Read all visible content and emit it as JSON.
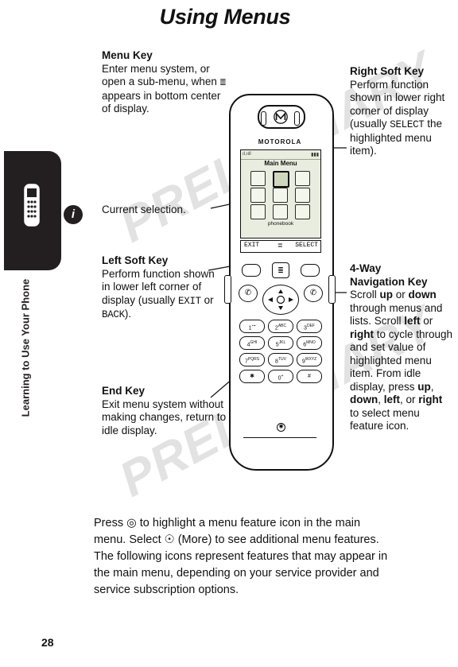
{
  "page": {
    "title": "Using Menus",
    "number": "28",
    "side_tab_label": "Learning to Use Your Phone",
    "watermark": "PRELIMINARY"
  },
  "callouts": {
    "menu_key": {
      "heading": "Menu Key",
      "body_1": "Enter menu system, or open a sub-menu, when ",
      "body_2": " appears in bottom center of display."
    },
    "current_selection": {
      "text": "Current selection."
    },
    "left_soft_key": {
      "heading": "Left Soft Key",
      "body_1": "Perform function shown in lower left corner of display (usually ",
      "mono_1": "EXIT",
      "body_2": " or ",
      "mono_2": "BACK",
      "body_3": ")."
    },
    "end_key": {
      "heading": "End Key",
      "body": "Exit menu system without making changes, return to idle display."
    },
    "right_soft_key": {
      "heading": "Right Soft Key",
      "body_1": "Perform function shown in lower right corner of display (usually ",
      "mono_1": "SELECT",
      "body_2": " the highlighted menu item)."
    },
    "four_way_key": {
      "heading_1": "4-Way",
      "heading_2": "Navigation Key",
      "body_1": "Scroll ",
      "b1": "up",
      "body_2": " or ",
      "b2": "down",
      "body_3": " through menus and lists. Scroll ",
      "b3": "left",
      "body_4": " or ",
      "b4": "right",
      "body_5": " to cycle through and set value of highlighted menu item. From idle display, press ",
      "b5": "up",
      "body_6": ", ",
      "b6": "down",
      "body_7": ", ",
      "b7": "left",
      "body_8": ", or ",
      "b8": "right",
      "body_9": " to select menu feature icon."
    }
  },
  "phone": {
    "brand": "MOTOROLA",
    "screen": {
      "signal": "ıl.ııll",
      "battery": "▮▮▮",
      "title": "Main Menu",
      "caption": "phonebook",
      "icons": [
        "messages-icon",
        "phonebook-icon",
        "recent-calls-icon",
        "settings-icon",
        "games-icon",
        "browser-icon",
        "more-icon",
        "calendar-icon",
        "tools-icon"
      ]
    },
    "soft_bar": {
      "left": "EXIT",
      "center": "≣",
      "right": "SELECT"
    },
    "keys": {
      "menu": "≣",
      "send": "✆",
      "end": "✆",
      "keypad": [
        {
          "num": "1",
          "sub": "⊶"
        },
        {
          "num": "2",
          "sub": "ABC"
        },
        {
          "num": "3",
          "sub": "DEF"
        },
        {
          "num": "4",
          "sub": "GHI"
        },
        {
          "num": "5",
          "sub": "JKL"
        },
        {
          "num": "6",
          "sub": "MNO"
        },
        {
          "num": "7",
          "sub": "PQRS"
        },
        {
          "num": "8",
          "sub": "TUV"
        },
        {
          "num": "9",
          "sub": "WXYZ"
        },
        {
          "num": "✱",
          "sub": ""
        },
        {
          "num": "0",
          "sub": "+"
        },
        {
          "num": "#",
          "sub": ""
        }
      ],
      "mic": "◉"
    }
  },
  "body_paragraph": {
    "p1": "Press ",
    "icon1": "nav-key-icon",
    "p2": " to highlight a menu feature icon in the main menu. Select ",
    "icon2": "more-icon",
    "p3": " (More) to see additional menu features. The following icons represent features that may appear in the main menu, depending on your service provider and service subscription options."
  }
}
